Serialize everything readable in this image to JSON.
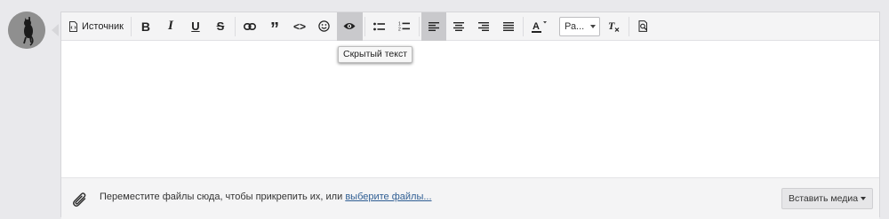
{
  "toolbar": {
    "source_label": "Источник",
    "bold_label": "B",
    "italic_label": "I",
    "underline_label": "U",
    "strike_label": "S",
    "quote_label": "”",
    "code_label": "<>",
    "font_select_value": "Ра...",
    "hidden_text_tooltip": "Скрытый текст",
    "active_button": "hidden-text",
    "active_alignment": "align-left"
  },
  "bottom": {
    "drop_text": "Переместите файлы сюда, чтобы прикрепить их, или ",
    "choose_files_link": "выберите файлы...",
    "insert_media_label": "Вставить медиа"
  },
  "colors": {
    "page_background": "#e9e9ec",
    "toolbar_background": "#f4f4f5",
    "active_button": "#c9c9cc",
    "link": "#2f5e93"
  }
}
